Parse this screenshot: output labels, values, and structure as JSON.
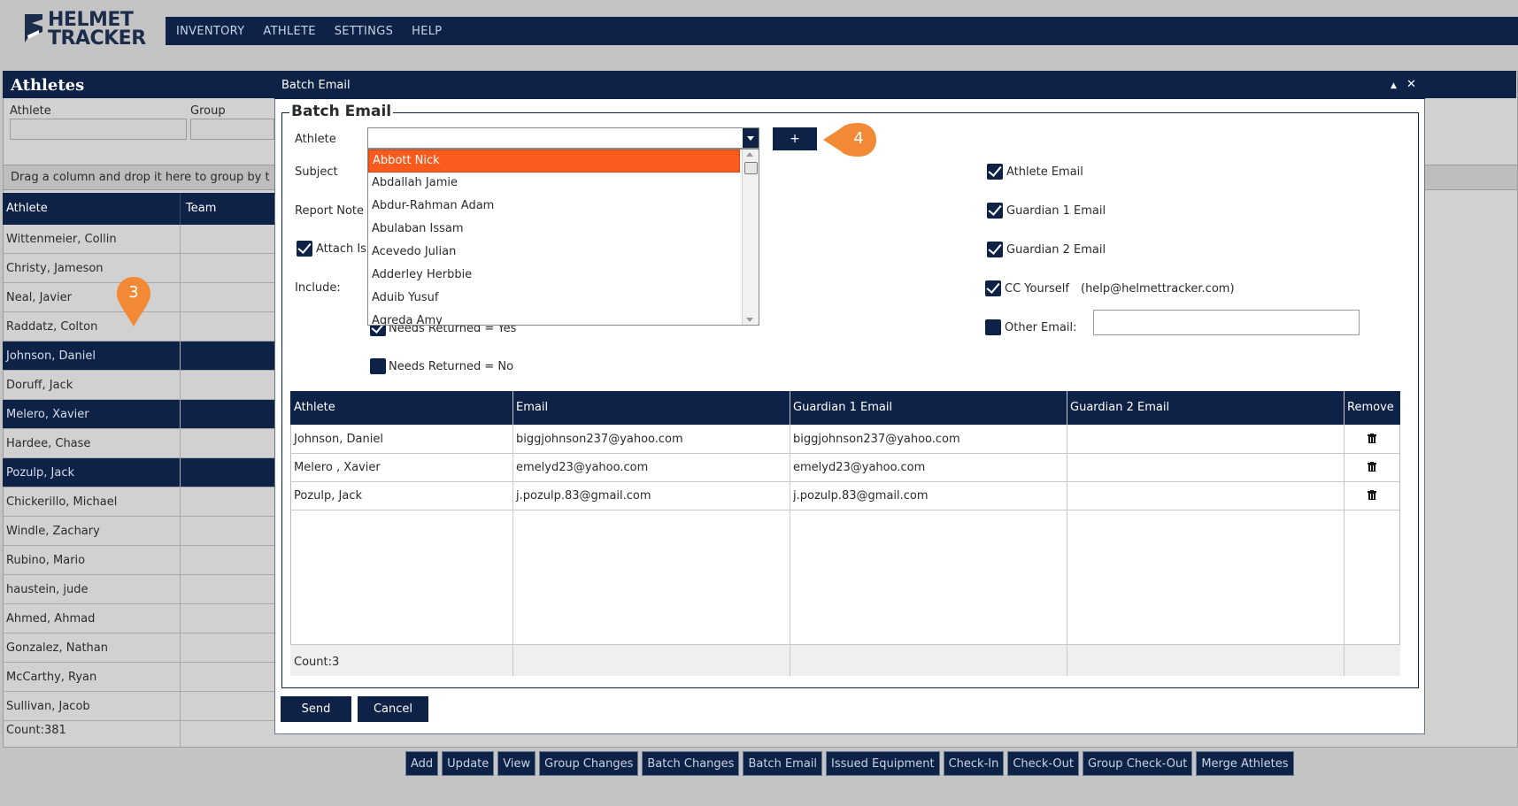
{
  "app": {
    "logo_line1": "HELMET",
    "logo_line2": "TRACKER"
  },
  "topnav": [
    "INVENTORY",
    "ATHLETE",
    "SETTINGS",
    "HELP"
  ],
  "background": {
    "title": "Athletes",
    "filter_athlete_label": "Athlete",
    "filter_group_label": "Group",
    "group_bar_text": "Drag a column and drop it here to group by t",
    "columns": [
      "Athlete",
      "Team"
    ],
    "rows": [
      {
        "name": "Wittenmeier, Collin",
        "selected": false
      },
      {
        "name": "Christy, Jameson",
        "selected": false
      },
      {
        "name": "Neal, Javier",
        "selected": false
      },
      {
        "name": "Raddatz, Colton",
        "selected": false
      },
      {
        "name": "Johnson, Daniel",
        "selected": true
      },
      {
        "name": "Doruff, Jack",
        "selected": false
      },
      {
        "name": "Melero, Xavier",
        "selected": true
      },
      {
        "name": "Hardee, Chase",
        "selected": false
      },
      {
        "name": "Pozulp, Jack",
        "selected": true
      },
      {
        "name": "Chickerillo, Michael",
        "selected": false
      },
      {
        "name": "Windle, Zachary",
        "selected": false
      },
      {
        "name": "Rubino, Mario",
        "selected": false
      },
      {
        "name": "haustein, jude",
        "selected": false
      },
      {
        "name": "Ahmed, Ahmad",
        "selected": false
      },
      {
        "name": "Gonzalez, Nathan",
        "selected": false
      },
      {
        "name": "McCarthy, Ryan",
        "selected": false
      },
      {
        "name": "Sullivan, Jacob",
        "selected": false
      }
    ],
    "count": "Count:381",
    "bottom_buttons": [
      "Add",
      "Update",
      "View",
      "Group Changes",
      "Batch Changes",
      "Batch Email",
      "Issued Equipment",
      "Check-In",
      "Check-Out",
      "Group Check-Out",
      "Merge Athletes"
    ],
    "step_marker": "3"
  },
  "modal": {
    "title": "Batch Email",
    "legend": "Batch Email",
    "athlete_label": "Athlete",
    "athlete_value": "",
    "add_label": "+",
    "step_marker": "4",
    "subject_label": "Subject",
    "report_note_label": "Report Note",
    "attach_label": "Attach Is",
    "include_label": "Include:",
    "needs_returned_yes": "Needs Returned = Yes",
    "needs_returned_no": "Needs Returned = No",
    "dropdown_items": [
      "Abbott Nick",
      "Abdallah Jamie",
      "Abdur-Rahman Adam",
      "Abulaban  Issam",
      "Acevedo Julian",
      "Adderley Herbbie",
      "Aduib Yusuf",
      "Agreda Amy"
    ],
    "athlete_email_label": "Athlete Email",
    "guardian1_email_label": "Guardian 1 Email",
    "guardian2_email_label": "Guardian 2 Email",
    "cc_yourself_label": "CC Yourself",
    "cc_address": "(help@helmettracker.com)",
    "other_email_label": "Other Email:",
    "other_email_value": "",
    "grid_columns": [
      "Athlete",
      "Email",
      "Guardian 1 Email",
      "Guardian 2 Email",
      "Remove"
    ],
    "grid_rows": [
      {
        "athlete": "Johnson, Daniel",
        "email": "biggjohnson237@yahoo.com",
        "g1": "biggjohnson237@yahoo.com",
        "g2": ""
      },
      {
        "athlete": "Melero , Xavier",
        "email": "emelyd23@yahoo.com",
        "g1": "emelyd23@yahoo.com",
        "g2": ""
      },
      {
        "athlete": "Pozulp, Jack",
        "email": "j.pozulp.83@gmail.com",
        "g1": "j.pozulp.83@gmail.com",
        "g2": ""
      }
    ],
    "grid_count": "Count:3",
    "send_label": "Send",
    "cancel_label": "Cancel",
    "min_icon": "▲",
    "close_icon": "✕"
  },
  "colors": {
    "navy": "#0d2246",
    "highlight": "#fa5b1c",
    "marker": "#f28a35"
  }
}
